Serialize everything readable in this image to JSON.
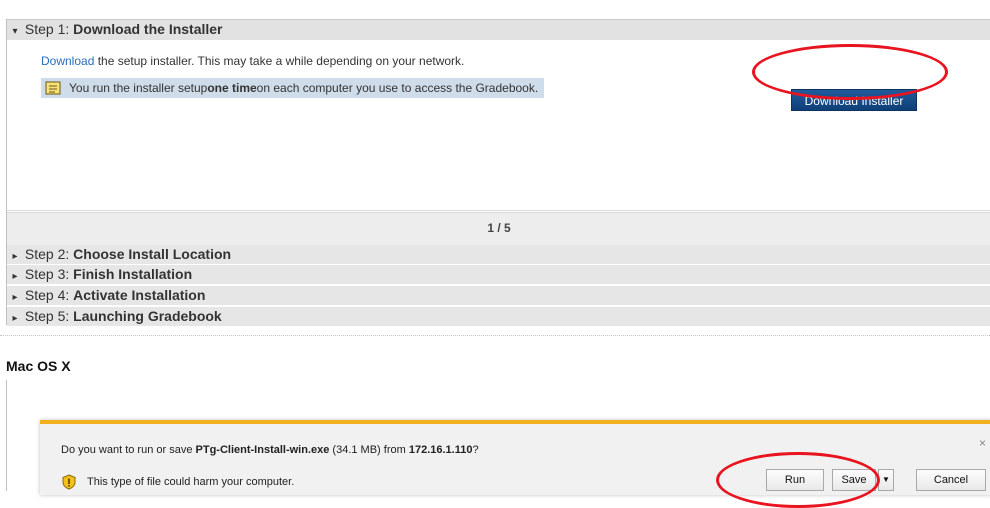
{
  "steps": [
    {
      "prefix": "Step 1: ",
      "name": "Download the Installer",
      "expanded": true
    },
    {
      "prefix": "Step 2: ",
      "name": "Choose Install Location",
      "expanded": false
    },
    {
      "prefix": "Step 3: ",
      "name": "Finish Installation",
      "expanded": false
    },
    {
      "prefix": "Step 4: ",
      "name": "Activate Installation",
      "expanded": false
    },
    {
      "prefix": "Step 5: ",
      "name": "Launching Gradebook",
      "expanded": false
    }
  ],
  "step1": {
    "link_text": "Download",
    "desc_rest": " the setup installer. This may take a while depending on your network.",
    "note_pre": "You run the installer setup ",
    "note_bold": "one time",
    "note_post": " on each computer you use to access the Gradebook.",
    "download_button": "Download Installer"
  },
  "pager": {
    "text": "1 / 5"
  },
  "mac_section": {
    "title": "Mac OS X"
  },
  "download_bar": {
    "q_pre": "Do you want to run or save ",
    "filename": "PTg-Client-Install-win.exe",
    "q_size": " (34.1 MB) from ",
    "host": "172.16.1.110",
    "q_end": "?",
    "warning": "This type of file could harm your computer.",
    "run": "Run",
    "save": "Save",
    "cancel": "Cancel",
    "close": "×"
  },
  "icons": {
    "expanded_arrow": "▾",
    "collapsed_arrow": "▸",
    "dropdown_arrow": "▼"
  },
  "colors": {
    "accent_button": "#1f5b9c",
    "link": "#2a6ebb",
    "annotation_circle": "#e8141f",
    "download_bar_stripe": "#f2b01e"
  }
}
